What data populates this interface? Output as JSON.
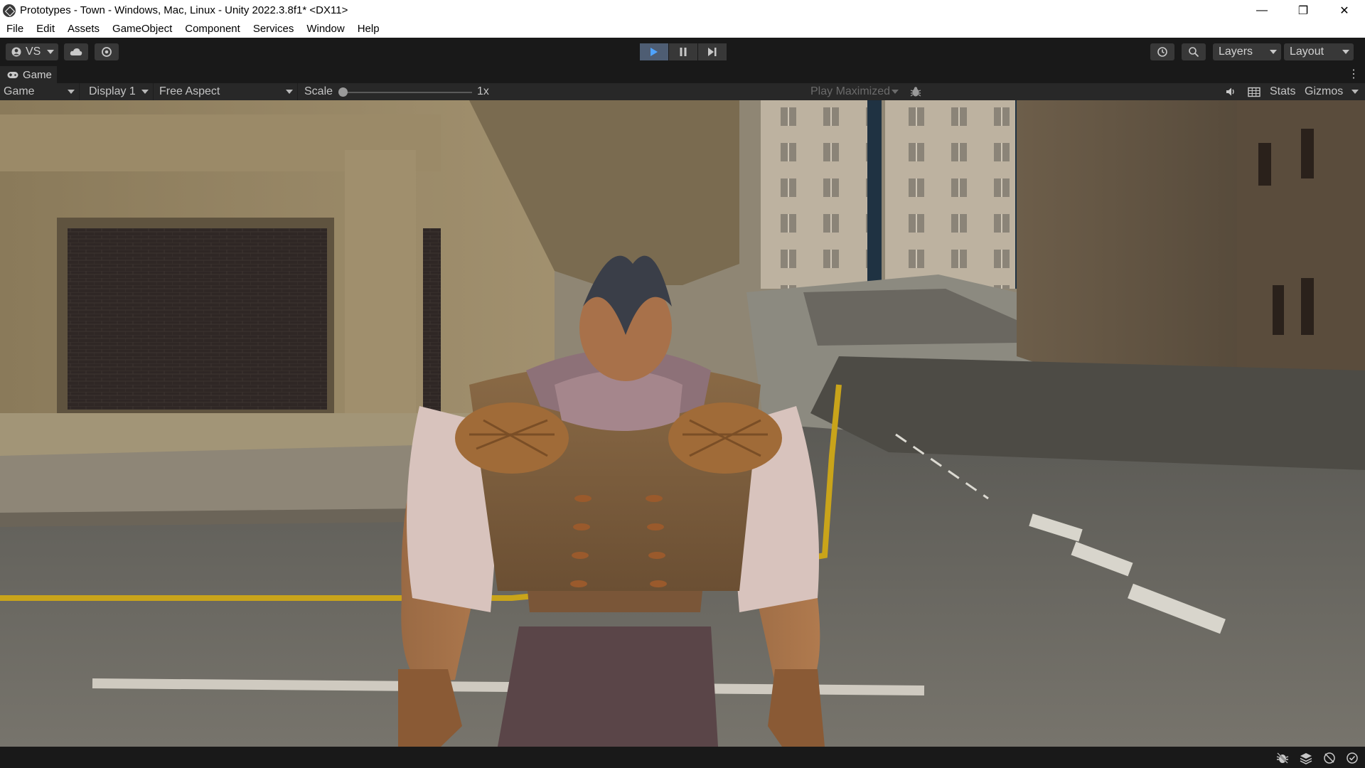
{
  "window": {
    "title": "Prototypes - Town - Windows, Mac, Linux - Unity 2022.3.8f1* <DX11>",
    "minimize": "—",
    "restore": "❐",
    "close": "✕"
  },
  "menu": {
    "items": [
      "File",
      "Edit",
      "Assets",
      "GameObject",
      "Component",
      "Services",
      "Window",
      "Help"
    ]
  },
  "toolbar": {
    "account_label": "VS",
    "layers_label": "Layers",
    "layout_label": "Layout",
    "play_state": "playing"
  },
  "game_tab": {
    "label": "Game"
  },
  "game_bar": {
    "view_mode": "Game",
    "display": "Display 1",
    "aspect": "Free Aspect",
    "scale_label": "Scale",
    "scale_value": "1x",
    "scale_fraction": 0.0,
    "play_mode": "Play Maximized",
    "stats_label": "Stats",
    "gizmos_label": "Gizmos"
  },
  "colors": {
    "editor_bg": "#191919",
    "panel_bg": "#282828",
    "button_bg": "#383838",
    "play_active": "#4e5d73",
    "play_icon": "#4fa3ff",
    "road_line_yellow": "#c9a41a"
  },
  "icons": {
    "app": "unity-logo-icon",
    "account": "account-icon",
    "cloud": "cloud-icon",
    "collab": "collab-settings-icon",
    "play": "play-icon",
    "pause": "pause-icon",
    "step": "step-icon",
    "history": "history-icon",
    "search": "search-icon",
    "gamepad": "gamepad-icon",
    "bug": "bug-icon",
    "audio": "audio-icon",
    "grid": "grid-icon"
  }
}
